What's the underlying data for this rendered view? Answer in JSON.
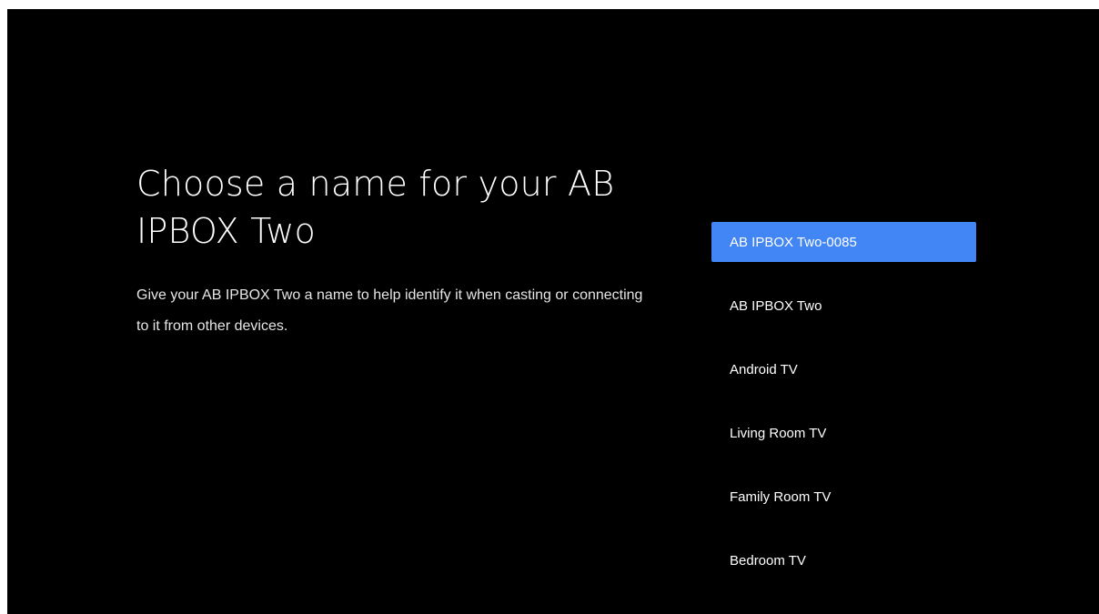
{
  "setup": {
    "title": "Choose a name for your AB IPBOX Two",
    "description": "Give your AB IPBOX Two a name to help identify it when casting or connecting to it from other devices.",
    "accent_color": "#4285f4",
    "name_options": [
      {
        "label": "AB IPBOX Two-0085",
        "selected": true
      },
      {
        "label": "AB IPBOX Two",
        "selected": false
      },
      {
        "label": "Android TV",
        "selected": false
      },
      {
        "label": "Living Room TV",
        "selected": false
      },
      {
        "label": "Family Room TV",
        "selected": false
      },
      {
        "label": "Bedroom TV",
        "selected": false
      }
    ]
  }
}
